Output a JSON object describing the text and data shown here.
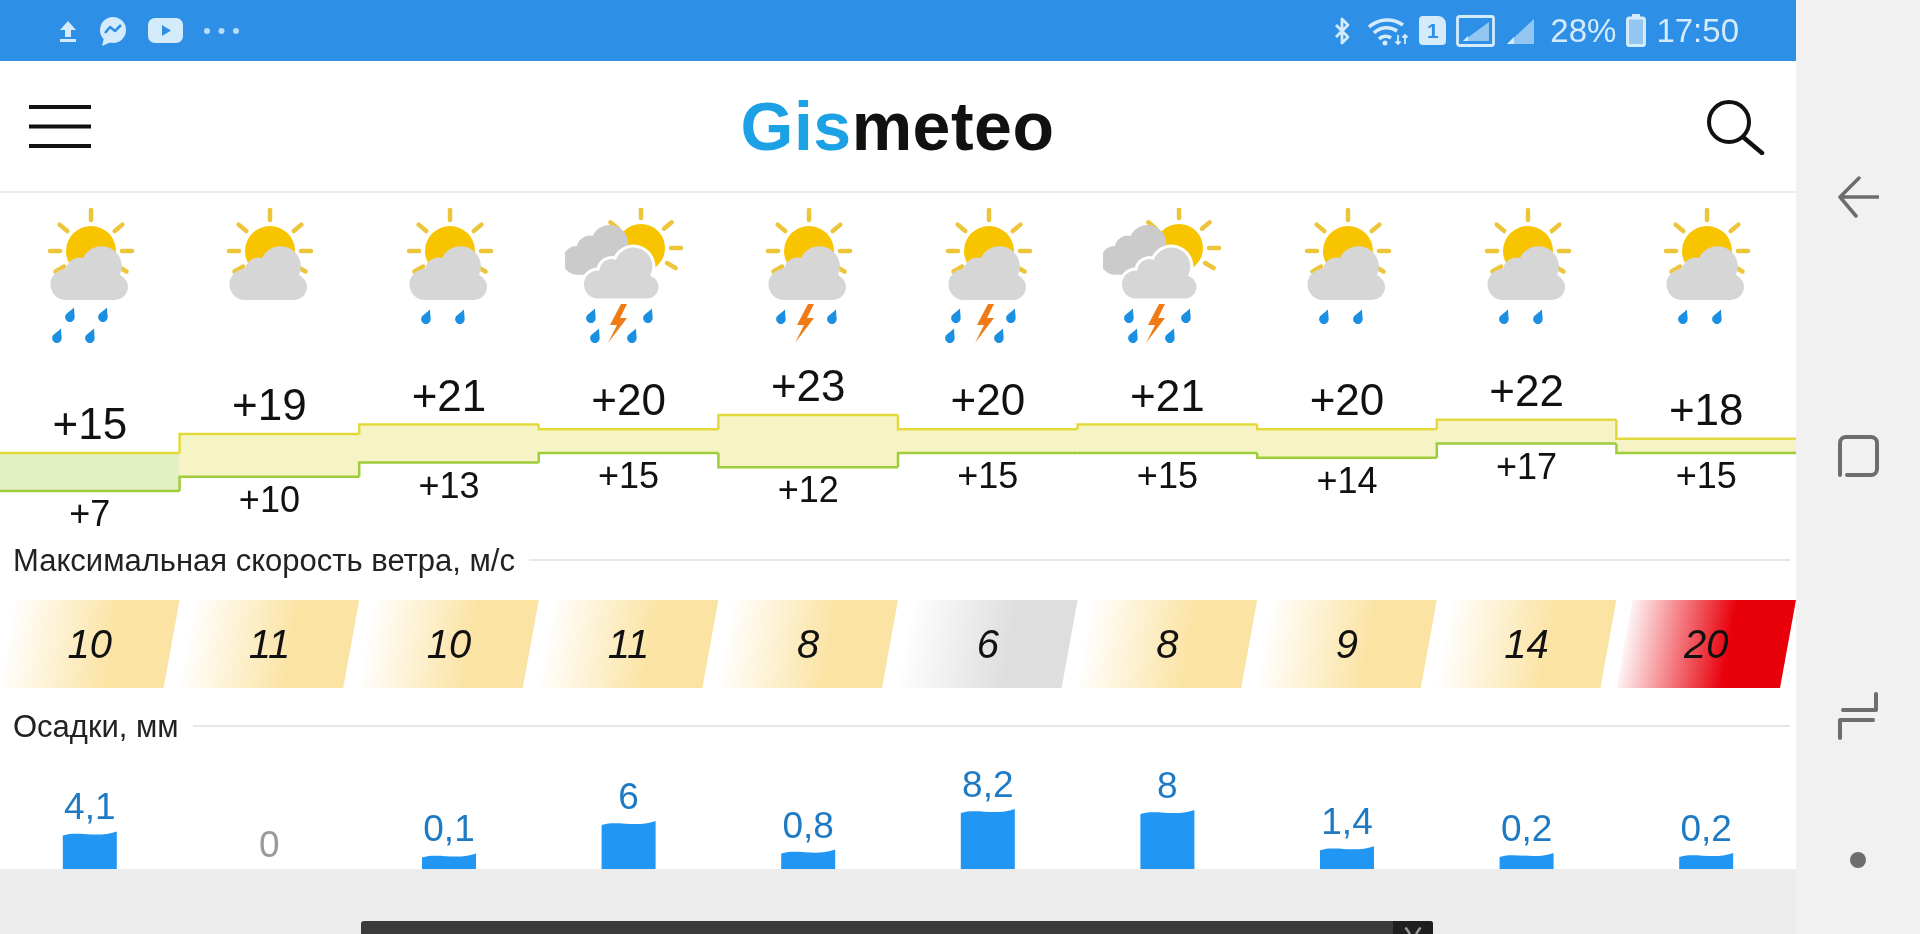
{
  "status_bar": {
    "sim_slot": "1",
    "battery": "28%",
    "time": "17:50"
  },
  "header": {
    "logo": {
      "accent": "Gis",
      "rest": "meteo"
    }
  },
  "forecast": {
    "conditions": [
      {
        "kind": "showers"
      },
      {
        "kind": "cloudy"
      },
      {
        "kind": "rain"
      },
      {
        "kind": "storm"
      },
      {
        "kind": "thunder"
      },
      {
        "kind": "thundershowers"
      },
      {
        "kind": "storm"
      },
      {
        "kind": "rain"
      },
      {
        "kind": "rain"
      },
      {
        "kind": "rain"
      }
    ],
    "temperatures": [
      {
        "max": "+15",
        "min": "+7"
      },
      {
        "max": "+19",
        "min": "+10"
      },
      {
        "max": "+21",
        "min": "+13"
      },
      {
        "max": "+20",
        "min": "+15"
      },
      {
        "max": "+23",
        "min": "+12"
      },
      {
        "max": "+20",
        "min": "+15"
      },
      {
        "max": "+21",
        "min": "+15"
      },
      {
        "max": "+20",
        "min": "+14"
      },
      {
        "max": "+22",
        "min": "+17"
      },
      {
        "max": "+18",
        "min": "+15"
      }
    ],
    "wind": {
      "title": "Максимальная скорость ветра, м/с",
      "speeds": [
        {
          "value": "10",
          "color": "#fbe3a3"
        },
        {
          "value": "11",
          "color": "#fbe3a3"
        },
        {
          "value": "10",
          "color": "#fbe3a3"
        },
        {
          "value": "11",
          "color": "#fbe3a3"
        },
        {
          "value": "8",
          "color": "#fbe3a3"
        },
        {
          "value": "6",
          "color": "#dedede"
        },
        {
          "value": "8",
          "color": "#fbe3a3"
        },
        {
          "value": "9",
          "color": "#fbe3a3"
        },
        {
          "value": "14",
          "color": "#fbe3a3"
        },
        {
          "value": "20",
          "color": "#e8000b"
        }
      ]
    },
    "precipitation": {
      "title": "Осадки, мм",
      "amounts": [
        "4,1",
        "0",
        "0,1",
        "6",
        "0,8",
        "8,2",
        "8",
        "1,4",
        "0,2",
        "0,2"
      ]
    }
  }
}
